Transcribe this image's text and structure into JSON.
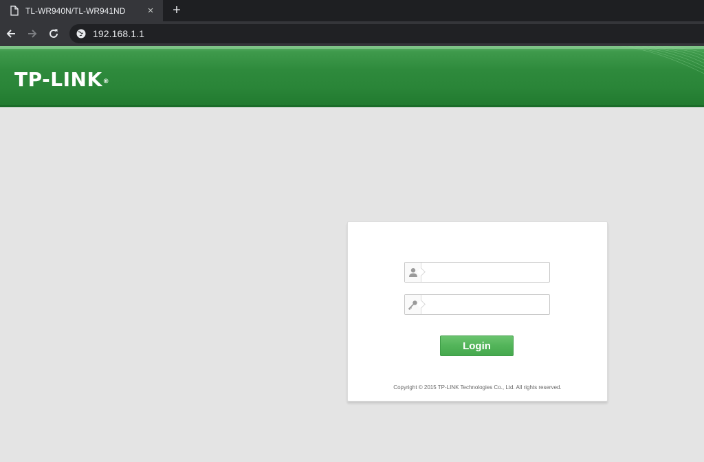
{
  "browser": {
    "tab_title": "TL-WR940N/TL-WR941ND",
    "tab_close": "×",
    "new_tab": "+",
    "url": "192.168.1.1",
    "icons": [
      "page-icon",
      "close-icon",
      "plus-icon",
      "back-icon",
      "forward-icon",
      "reload-icon",
      "globe-icon"
    ]
  },
  "header": {
    "logo_text": "TP-LINK",
    "logo_mark": "®",
    "brand_color": "#2e8a3c"
  },
  "login": {
    "username_value": "",
    "password_value": "",
    "username_icon": "user-icon",
    "password_icon": "key-icon",
    "button_label": "Login",
    "button_color": "#52b459",
    "copyright": "Copyright © 2015 TP-LINK Technologies Co., Ltd. All rights reserved."
  }
}
